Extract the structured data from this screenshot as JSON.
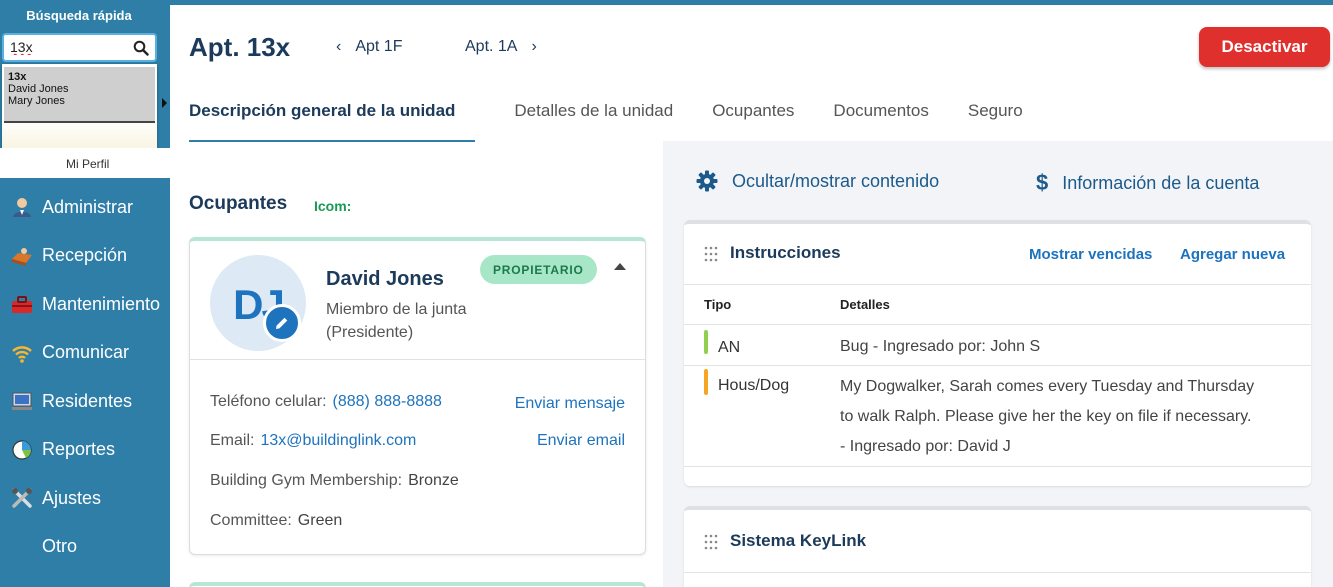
{
  "sidebar": {
    "quick_search_title": "Búsqueda rápida",
    "search_value": "13x",
    "dropdown_items": [
      "13x",
      "David Jones",
      "Mary Jones"
    ],
    "profile_label": "Mi Perfil",
    "nav": [
      {
        "label": "Administrar",
        "icon": "admin-user-icon"
      },
      {
        "label": "Recepción",
        "icon": "front-desk-package-icon"
      },
      {
        "label": "Mantenimiento",
        "icon": "toolbox-icon"
      },
      {
        "label": "Comunicar",
        "icon": "wifi-broadcast-icon"
      },
      {
        "label": "Residentes",
        "icon": "monitor-icon"
      },
      {
        "label": "Reportes",
        "icon": "pie-chart-icon"
      },
      {
        "label": "Ajustes",
        "icon": "tools-icon"
      },
      {
        "label": "Otro",
        "icon": ""
      }
    ]
  },
  "header": {
    "title": "Apt. 13x",
    "prev_label": "Apt 1F",
    "next_label": "Apt. 1A",
    "deactivate_label": "Desactivar"
  },
  "tabs": [
    {
      "label": "Descripción general de la unidad",
      "active": true
    },
    {
      "label": "Detalles de la unidad",
      "active": false
    },
    {
      "label": "Ocupantes",
      "active": false
    },
    {
      "label": "Documentos",
      "active": false
    },
    {
      "label": "Seguro",
      "active": false
    }
  ],
  "occupants": {
    "heading": "Ocupantes",
    "icom": "Icom:",
    "person": {
      "initials": "DJ",
      "name": "David Jones",
      "role_line1": "Miembro de la junta",
      "role_line2": "(Presidente)",
      "badge": "PROPIETARIO",
      "phone_label": "Teléfono celular:",
      "phone_value": "(888) 888-8888",
      "phone_action": "Enviar mensaje",
      "email_label": "Email:",
      "email_value": "13x@buildinglink.com",
      "email_action": "Enviar email",
      "gym_label": "Building Gym Membership:",
      "gym_value": "Bronze",
      "committee_label": "Committee:",
      "committee_value": "Green"
    }
  },
  "right": {
    "toggle_content": "Ocultar/mostrar contenido",
    "account_info": "Información de la cuenta",
    "instructions": {
      "title": "Instrucciones",
      "show_expired": "Mostrar vencidas",
      "add_new": "Agregar nueva",
      "col_type": "Tipo",
      "col_details": "Detalles",
      "rows": [
        {
          "type": "AN",
          "color": "#8fd14f",
          "details": [
            "Bug  - Ingresado por: John S"
          ]
        },
        {
          "type": "Hous/Dog",
          "color": "#f5a623",
          "details": [
            "My Dogwalker, Sarah comes every Tuesday and Thursday",
            "to walk Ralph. Please give her the key on file if necessary.",
            "- Ingresado por: David J"
          ]
        }
      ]
    },
    "keylink": {
      "title": "Sistema KeyLink"
    }
  },
  "colors": {
    "sidebar": "#2e7ea8",
    "accent": "#1e73be",
    "danger": "#e0302e",
    "badge_bg": "#a8e6c8"
  }
}
